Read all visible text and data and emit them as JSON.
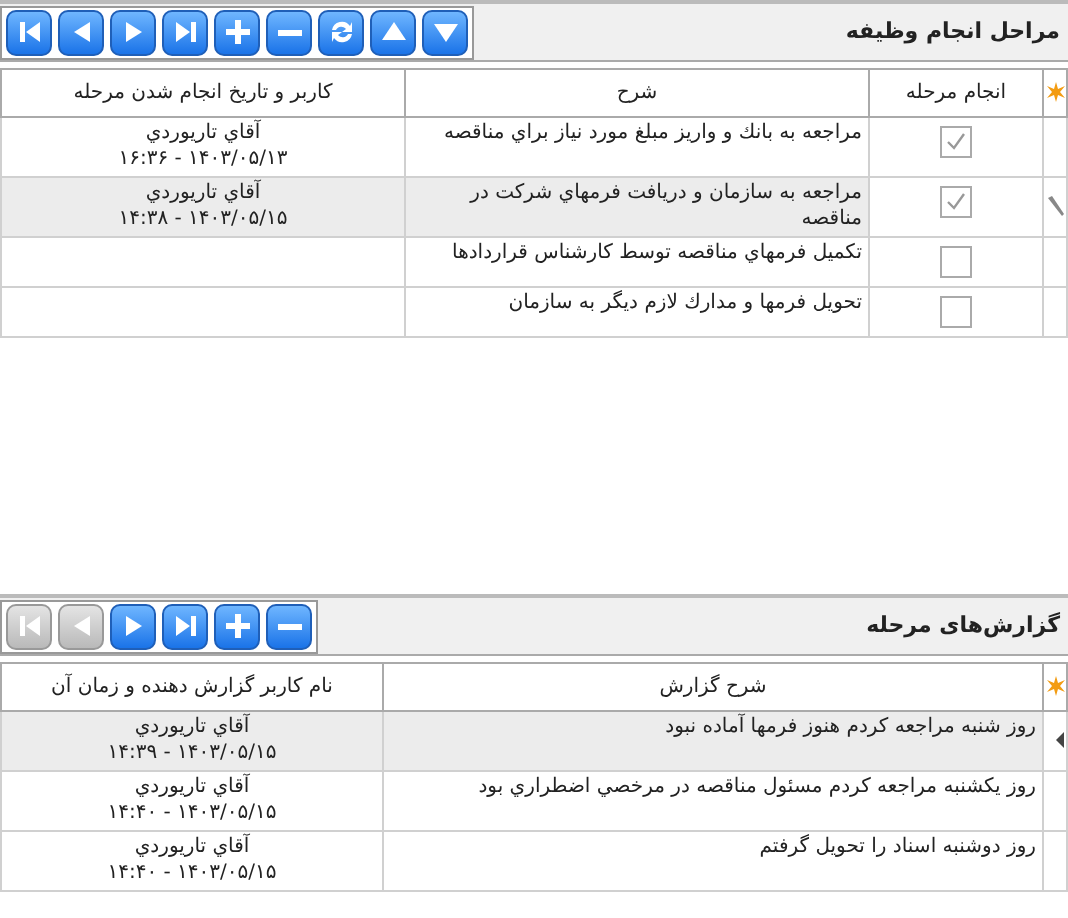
{
  "panels": [
    {
      "title": "مراحل انجام وظیفه",
      "buttons": [
        {
          "kind": "first",
          "disabled": false
        },
        {
          "kind": "prev",
          "disabled": false
        },
        {
          "kind": "next",
          "disabled": false
        },
        {
          "kind": "last",
          "disabled": false
        },
        {
          "kind": "add",
          "disabled": false
        },
        {
          "kind": "remove",
          "disabled": false
        },
        {
          "kind": "refresh",
          "disabled": false
        },
        {
          "kind": "up",
          "disabled": false
        },
        {
          "kind": "down",
          "disabled": false
        }
      ],
      "columns": [
        "انجام مرحله",
        "شرح",
        "کاربر و تاریخ انجام شدن مرحله"
      ],
      "rows": [
        {
          "done": true,
          "description": "مراجعه به بانك و واريز مبلغ مورد نياز براي مناقصه",
          "user": "آقاي تاريوردي",
          "time": "۱۴۰۳/۰۵/۱۳ - ۱۶:۳۶",
          "selected": false,
          "editing": false
        },
        {
          "done": true,
          "description": "مراجعه به سازمان و دريافت فرمهاي شركت در مناقصه",
          "user": "آقاي تاريوردي",
          "time": "۱۴۰۳/۰۵/۱۵ - ۱۴:۳۸",
          "selected": true,
          "editing": true
        },
        {
          "done": false,
          "description": "تكميل فرمهاي مناقصه توسط كارشناس قراردادها",
          "selected": false,
          "editing": false
        },
        {
          "done": false,
          "description": "تحويل فرمها و مدارك لازم ديگر به سازمان",
          "selected": false,
          "editing": false
        }
      ]
    },
    {
      "title": "گزارش‌های مرحله",
      "buttons": [
        {
          "kind": "first",
          "disabled": true
        },
        {
          "kind": "prev",
          "disabled": true
        },
        {
          "kind": "next",
          "disabled": false
        },
        {
          "kind": "last",
          "disabled": false
        },
        {
          "kind": "add",
          "disabled": false
        },
        {
          "kind": "remove",
          "disabled": false
        }
      ],
      "columns": [
        "شرح گزارش",
        "نام کاربر گزارش دهنده و زمان آن"
      ],
      "rows": [
        {
          "description": "روز شنبه مراجعه كردم هنوز فرمها آماده نبود",
          "user": "آقاي تاريوردي",
          "time": "۱۴۰۳/۰۵/۱۵ - ۱۴:۳۹",
          "selected": true,
          "editing": false
        },
        {
          "description": "روز يكشنبه مراجعه كردم مسئول مناقصه در مرخصي اضطراري بود",
          "user": "آقاي تاريوردي",
          "time": "۱۴۰۳/۰۵/۱۵ - ۱۴:۴۰",
          "selected": false,
          "editing": false
        },
        {
          "description": "روز دوشنبه اسناد را تحويل گرفتم",
          "user": "آقاي تاريوردي",
          "time": "۱۴۰۳/۰۵/۱۵ - ۱۴:۴۰",
          "selected": false,
          "editing": false
        }
      ]
    }
  ]
}
